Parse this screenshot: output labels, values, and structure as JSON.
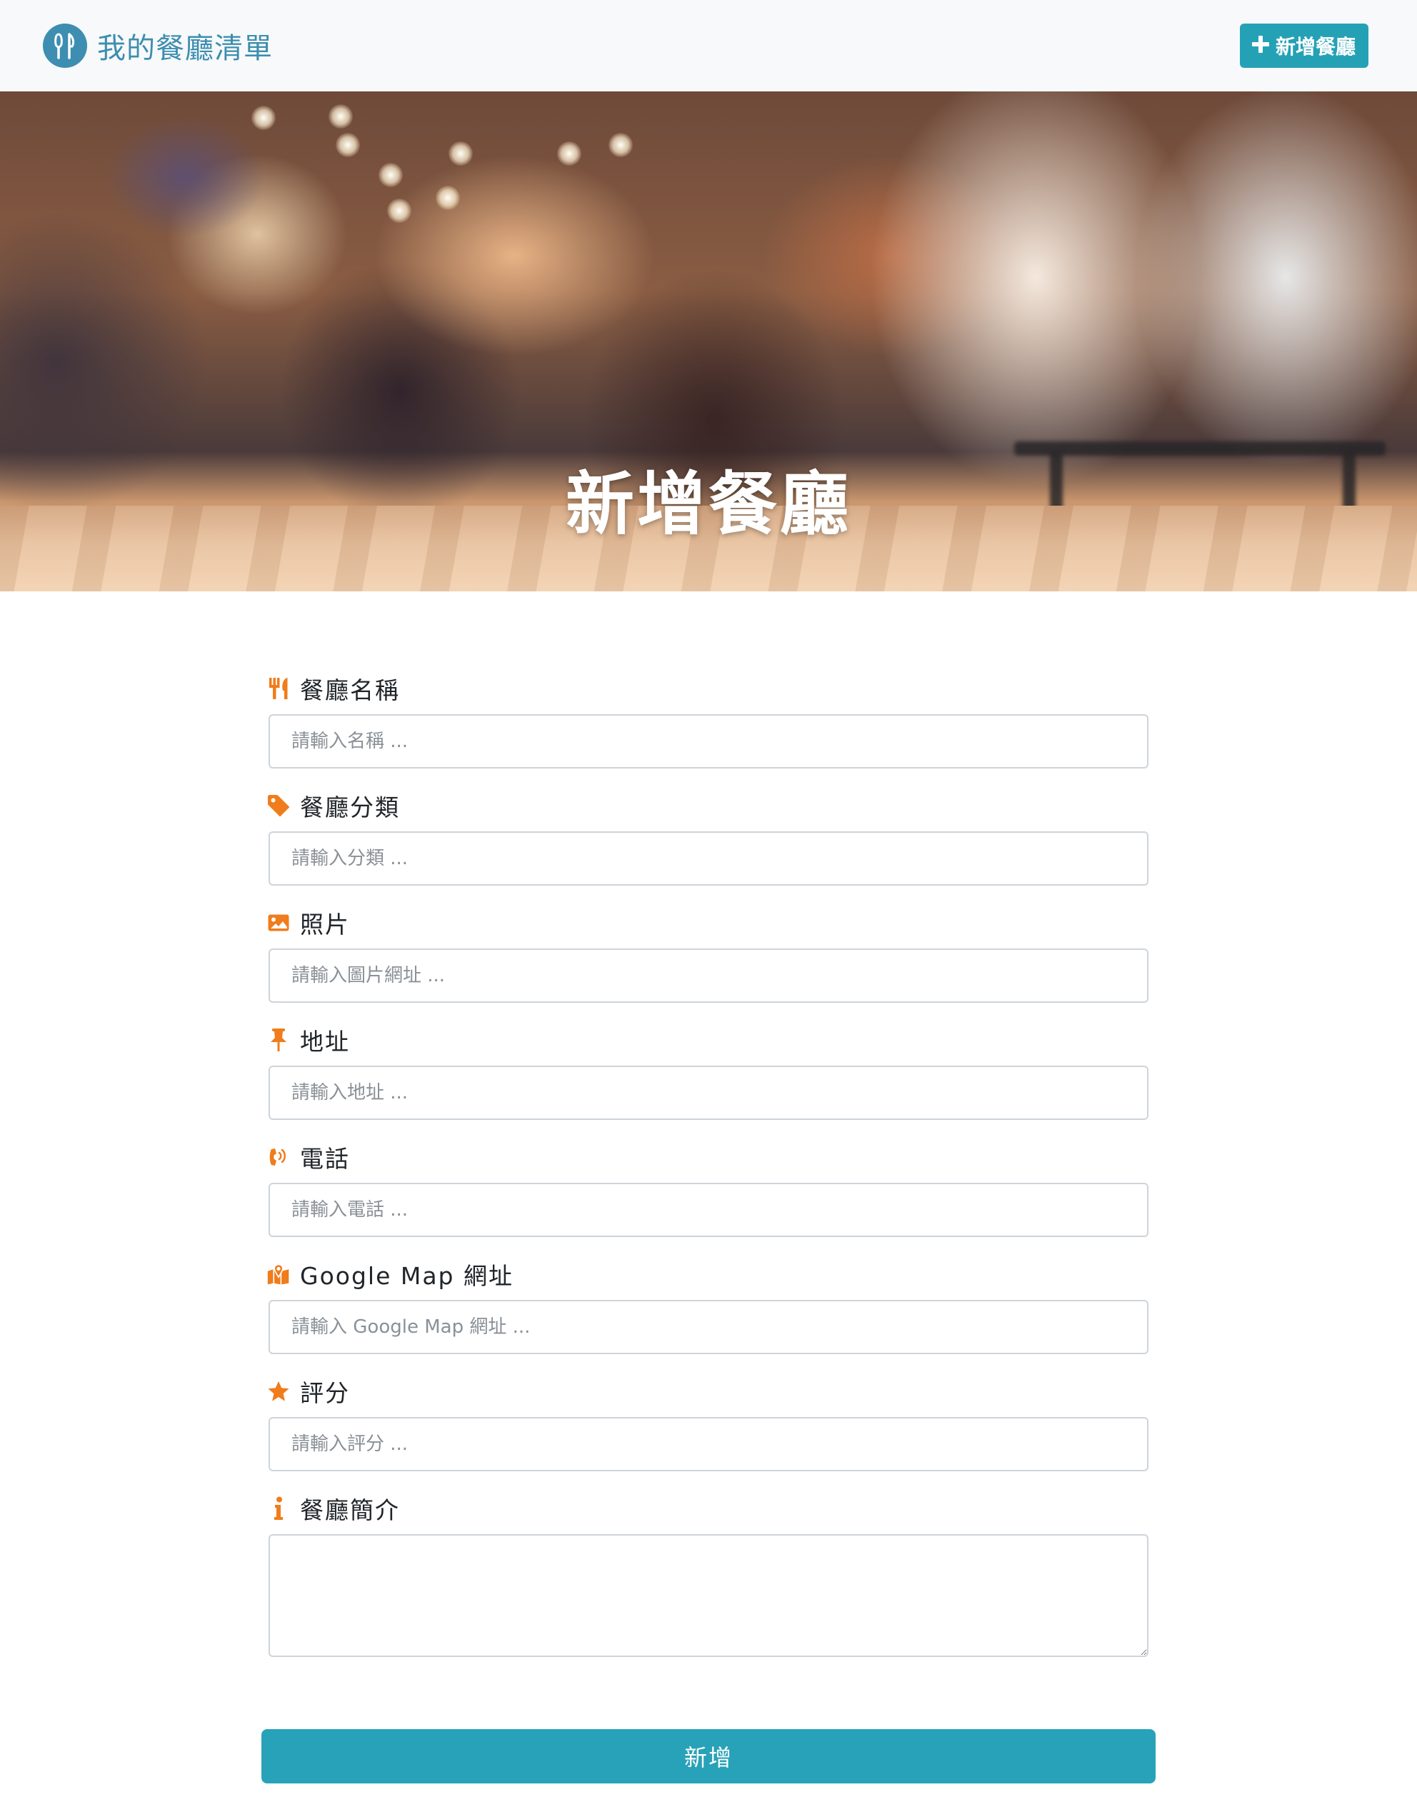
{
  "navbar": {
    "brand_title": "我的餐廳清單",
    "brand_icon": "utensils-icon",
    "add_button_label": "新增餐廳",
    "add_button_icon": "plus-icon"
  },
  "banner": {
    "title": "新增餐廳"
  },
  "form": {
    "fields": [
      {
        "label": "餐廳名稱",
        "icon": "utensils-icon",
        "placeholder": "請輸入名稱 ..."
      },
      {
        "label": "餐廳分類",
        "icon": "tag-icon",
        "placeholder": "請輸入分類 ..."
      },
      {
        "label": "照片",
        "icon": "image-icon",
        "placeholder": "請輸入圖片網址 ..."
      },
      {
        "label": "地址",
        "icon": "thumbtack-icon",
        "placeholder": "請輸入地址 ..."
      },
      {
        "label": "電話",
        "icon": "phone-volume-icon",
        "placeholder": "請輸入電話 ..."
      },
      {
        "label": "Google Map 網址",
        "icon": "map-marked-icon",
        "placeholder": "請輸入 Google Map 網址 ..."
      },
      {
        "label": "評分",
        "icon": "star-icon",
        "placeholder": "請輸入評分 ..."
      }
    ],
    "description": {
      "label": "餐廳簡介",
      "icon": "info-icon",
      "value": ""
    },
    "submit_label": "新增"
  },
  "colors": {
    "brand": "#3d8eb0",
    "accent_button": "#25a1b6",
    "icon_orange": "#f07c1b",
    "navbar_bg": "#f8f9fa"
  }
}
